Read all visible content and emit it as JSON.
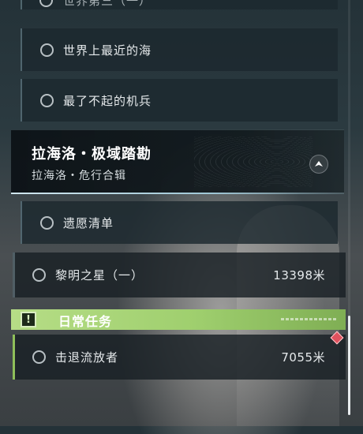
{
  "quests": {
    "top_cut": {
      "label": "世界第三（一）"
    },
    "items": [
      {
        "label": "世界上最近的海"
      },
      {
        "label": "最了不起的机兵"
      }
    ],
    "header": {
      "title": "拉海洛・极域踏勘",
      "subtitle": "拉海洛・危行合辑"
    },
    "items2": [
      {
        "label": "遗愿清单"
      }
    ],
    "main_quest": {
      "label": "黎明之星（一）",
      "distance": "13398米"
    }
  },
  "daily": {
    "title": "日常任务",
    "icon": "exclamation-icon",
    "items": [
      {
        "label": "击退流放者",
        "distance": "7055米"
      }
    ]
  },
  "colors": {
    "daily_accent": "#9fcf6e",
    "track_marker": "#e0525e"
  }
}
